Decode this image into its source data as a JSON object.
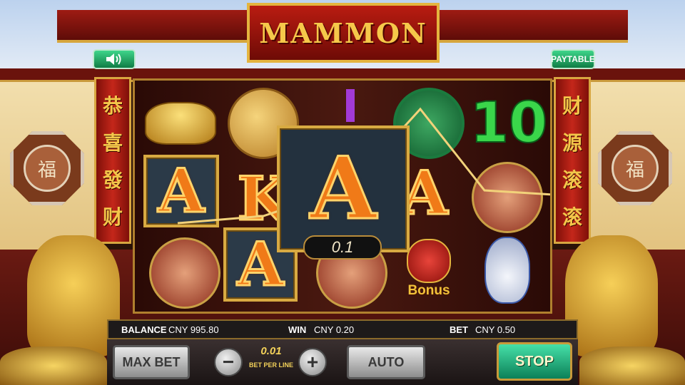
{
  "game": {
    "title": "MAMMON"
  },
  "top_buttons": {
    "sound_icon": "speaker-icon",
    "paytable_label": "PAYTABLE"
  },
  "banners": {
    "left": [
      "恭",
      "喜",
      "發",
      "财"
    ],
    "right": [
      "财",
      "源",
      "滚",
      "滚"
    ]
  },
  "medallion_char": "福",
  "reels": {
    "symbols": {
      "r1": [
        "gold ingot",
        "A",
        "lantern"
      ],
      "r2": [
        "red knot coin",
        "K",
        "A"
      ],
      "r3": [
        "purple bar",
        "A",
        "lantern"
      ],
      "r4": [
        "jade disc",
        "A",
        "bonus urn"
      ],
      "r5": [
        "10",
        "lantern",
        "porcelain vase"
      ]
    },
    "letters": {
      "a": "A",
      "k": "K",
      "ten": "10"
    },
    "win_amount": "0.1",
    "bonus_label": "Bonus"
  },
  "info": {
    "balance_label": "BALANCE",
    "balance_value": "CNY 995.80",
    "win_label": "WIN",
    "win_value": "CNY 0.20",
    "bet_label": "BET",
    "bet_value": "CNY 0.50"
  },
  "controls": {
    "max_bet_label": "MAX BET",
    "minus_label": "−",
    "plus_label": "+",
    "bet_per_line_value": "0.01",
    "bet_per_line_label": "BET PER LINE",
    "auto_label": "AUTO",
    "stop_label": "STOP"
  },
  "colors": {
    "accent_gold": "#f6c84a",
    "stop_green": "#0c8058",
    "temple_red": "#9e1b13"
  }
}
